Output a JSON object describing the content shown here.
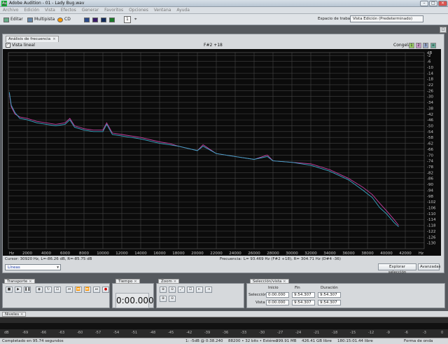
{
  "window": {
    "title": "Adobe Audition - 01 - Lady Bug.wav",
    "icon_letter": "Au"
  },
  "menu": [
    "Archivo",
    "Edición",
    "Vista",
    "Efectos",
    "Generar",
    "Favoritos",
    "Opciones",
    "Ventana",
    "Ayuda"
  ],
  "toolbar": {
    "edit": "Editar",
    "multitrack": "Multipista",
    "cd": "CD",
    "workspace_label": "Espacio de trabajo:",
    "workspace_value": "Vista Edición (Predeterminado)",
    "zoom_value": "1"
  },
  "panel": {
    "tab_label": "Análisis de frecuencia",
    "linear_view_label": "Vista lineal",
    "note_label": "F#2 +18",
    "freeze_label": "Congelar:",
    "freeze_slots": [
      "1",
      "2",
      "3"
    ]
  },
  "info": {
    "cursor": "Cursor:   30920 Hz, L=-86.26 dB, R=-85.75 dB",
    "frequency_label": "Frecuencia:",
    "frequency_value": "L= 93.469 Hz (F#2 +18), R= 304.71 Hz (D#4 -36)",
    "mode": "Líneas",
    "explore_button": "Explorar selección",
    "advanced_button": "Avanzadas"
  },
  "transport": {
    "tab": "Transporte"
  },
  "time": {
    "tab": "Tiempo",
    "value": "0:00.000"
  },
  "zoom": {
    "tab": "Zoom"
  },
  "selection": {
    "tab": "Selección/vista",
    "col_start": "Inicio",
    "col_end": "Fin",
    "col_duration": "Duración",
    "row_selection": "Selección",
    "row_view": "Vista",
    "sel_start": "0:00.000",
    "sel_end": "9:54.307",
    "sel_dur": "9:54.307",
    "view_start": "0:00.000",
    "view_end": "9:54.307",
    "view_dur": "9:54.307"
  },
  "levels": {
    "tab": "Niveles",
    "ticks": [
      "dB",
      "-69",
      "-66",
      "-63",
      "-60",
      "-57",
      "-54",
      "-51",
      "-48",
      "-45",
      "-42",
      "-39",
      "-36",
      "-33",
      "-30",
      "-27",
      "-24",
      "-21",
      "-18",
      "-15",
      "-12",
      "-9",
      "-6",
      "-3",
      "0"
    ]
  },
  "status": {
    "completed": "Completado en 95.74 segundos",
    "peak": "1: -5dB @ 0:38.240",
    "format": "88200 • 32 bits • Estéreo",
    "size": "399.91 MB",
    "free": "426.41 GB libre",
    "free_time": "180:15:01.44 libre",
    "mode": "Forma de onda"
  },
  "chart_data": {
    "type": "line",
    "x_unit": "Hz",
    "y_unit": "dB",
    "xlim": [
      0,
      44000
    ],
    "ylim": [
      -134,
      0
    ],
    "x_ticks": [
      2000,
      4000,
      6000,
      8000,
      10000,
      12000,
      14000,
      16000,
      18000,
      20000,
      22000,
      24000,
      26000,
      28000,
      30000,
      32000,
      34000,
      36000,
      38000,
      40000,
      42000
    ],
    "y_ticks": [
      -2,
      -6,
      -10,
      -14,
      -18,
      -22,
      -26,
      -30,
      -34,
      -38,
      -42,
      -46,
      -50,
      -54,
      -58,
      -62,
      -66,
      -70,
      -74,
      -78,
      -82,
      -86,
      -90,
      -94,
      -98,
      -102,
      -106,
      -110,
      -114,
      -118,
      -122,
      -126,
      -130
    ],
    "series": [
      {
        "color": "#c83fa0",
        "x": [
          100,
          300,
          700,
          1200,
          2000,
          3000,
          4000,
          5000,
          6000,
          6500,
          7000,
          8000,
          9000,
          10000,
          10400,
          11000,
          12000,
          14000,
          16000,
          17000,
          18000,
          20000,
          20600,
          22000,
          24000,
          26000,
          27400,
          28000,
          30000,
          32000,
          34000,
          36000,
          37500,
          38500,
          39300,
          40000,
          40800,
          41300
        ],
        "y": [
          -28,
          -37,
          -42,
          -44,
          -45,
          -47,
          -48,
          -49,
          -48,
          -45,
          -50,
          -52,
          -53,
          -53,
          -48,
          -55,
          -56,
          -58,
          -61,
          -62,
          -64,
          -67,
          -63,
          -69,
          -71,
          -73,
          -70,
          -74,
          -75,
          -76,
          -80,
          -86,
          -92,
          -97,
          -103,
          -108,
          -114,
          -118
        ]
      },
      {
        "color": "#3aa8c8",
        "x": [
          100,
          300,
          700,
          1200,
          2000,
          3000,
          4000,
          5000,
          6000,
          6500,
          7000,
          8000,
          9000,
          10000,
          10400,
          11000,
          12000,
          14000,
          16000,
          17000,
          18000,
          20000,
          20600,
          22000,
          24000,
          26000,
          27400,
          28000,
          30000,
          32000,
          34000,
          36000,
          37500,
          38500,
          39300,
          40000,
          40800,
          41300
        ],
        "y": [
          -27,
          -36,
          -41,
          -45,
          -46,
          -48,
          -49,
          -50,
          -49,
          -46,
          -51,
          -53,
          -54,
          -54,
          -49,
          -56,
          -57,
          -59,
          -62,
          -63,
          -64,
          -67,
          -64,
          -69,
          -71,
          -73,
          -71,
          -74,
          -75,
          -77,
          -81,
          -87,
          -94,
          -99,
          -106,
          -110,
          -116,
          -119
        ]
      }
    ]
  }
}
